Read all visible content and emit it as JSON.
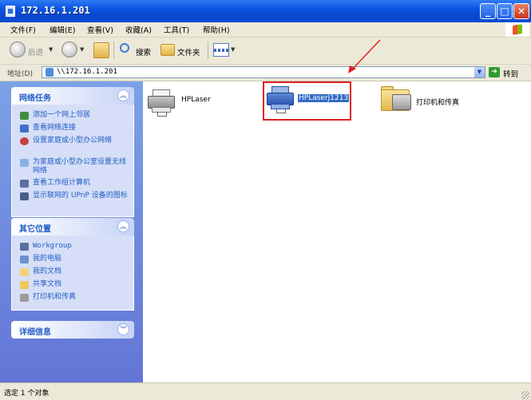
{
  "window": {
    "title": "172.16.1.201"
  },
  "menu": [
    "文件(F)",
    "编辑(E)",
    "查看(V)",
    "收藏(A)",
    "工具(T)",
    "帮助(H)"
  ],
  "toolbar": {
    "back": "后退",
    "search": "搜索",
    "folders": "文件夹"
  },
  "address": {
    "label": "地址(D)",
    "value": "\\\\172.16.1.201",
    "go": "转到"
  },
  "left_panel": {
    "network_tasks": {
      "title": "网络任务",
      "items": [
        "添加一个网上邻居",
        "查看网络连接",
        "设置家庭或小型办公网络",
        "为家庭或小型办公室设置无线网络",
        "查看工作组计算机",
        "显示联网的 UPnP 设备的图标"
      ]
    },
    "other_places": {
      "title": "其它位置",
      "items": [
        "Workgroup",
        "我的电脑",
        "我的文档",
        "共享文档",
        "打印机和传真"
      ]
    },
    "details": {
      "title": "详细信息"
    }
  },
  "content": {
    "items": [
      {
        "label": "HPLaser"
      },
      {
        "label": "HPLaserJ1213"
      },
      {
        "label": "打印机和传真"
      }
    ]
  },
  "status": {
    "text": "选定 1 个对象"
  },
  "colors": {
    "highlight": "#e02020",
    "selection": "#316ac5",
    "titlebar": "#0a55e0"
  }
}
